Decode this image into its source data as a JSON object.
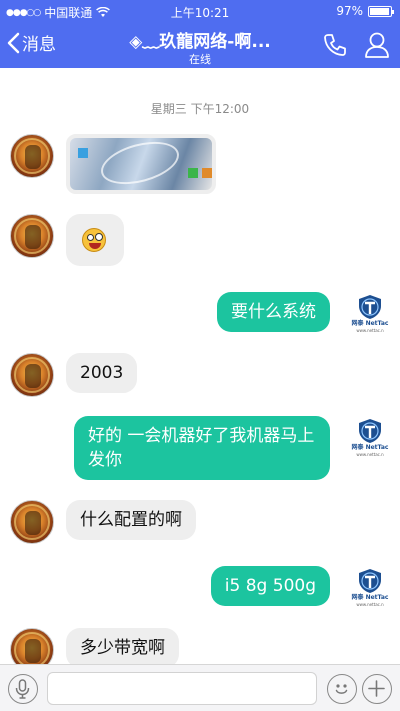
{
  "status_bar": {
    "carrier": "中国联通",
    "time": "上午10:21",
    "battery": "97%",
    "battery_level": 0.97
  },
  "nav": {
    "back_label": "消息",
    "title": "◈﹏玖龍网络-啊...",
    "subtitle": "在线"
  },
  "chat": {
    "timestamp": "星期三 下午12:00",
    "messages": [
      {
        "side": "left",
        "type": "image"
      },
      {
        "side": "left",
        "type": "emoji"
      },
      {
        "side": "right",
        "text": "要什么系统"
      },
      {
        "side": "left",
        "text": "2003"
      },
      {
        "side": "right",
        "text": "好的 一会机器好了我机器马上发你"
      },
      {
        "side": "left",
        "text": "什么配置的啊"
      },
      {
        "side": "right",
        "text": "i5 8g 500g"
      },
      {
        "side": "left",
        "text": "多少带宽啊"
      }
    ],
    "my_avatar": {
      "brand": "网泰 NetTac",
      "site": "www.nettac.n"
    }
  },
  "colors": {
    "nav_bg": "#4f6df0",
    "bubble_right": "#1cc49f",
    "bubble_left": "#eeeeee"
  },
  "input_bar": {
    "mic_icon": "microphone-icon",
    "emoji_icon": "smiley-icon",
    "add_icon": "plus-icon",
    "text_value": ""
  }
}
